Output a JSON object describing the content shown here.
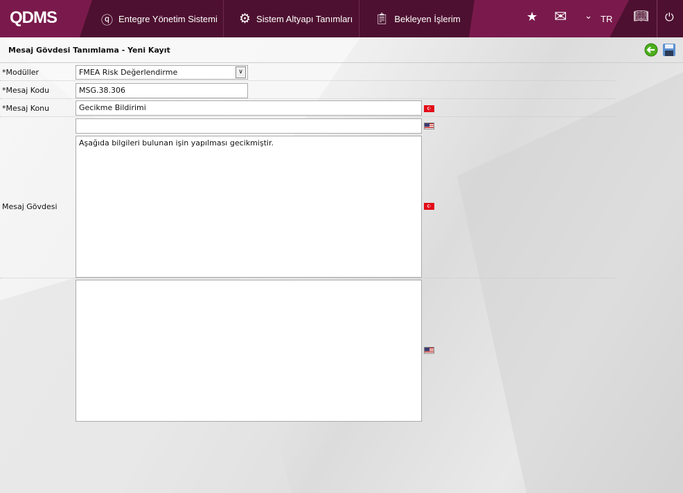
{
  "header": {
    "logo": "QDMS",
    "nav": [
      {
        "label": "Entegre Yönetim Sistemi",
        "icon": "q-icon"
      },
      {
        "label": "Sistem Altyapı Tanımları",
        "icon": "gear-icon"
      },
      {
        "label": "Bekleyen İşlerim",
        "icon": "clipboard-icon"
      }
    ],
    "language": "TR"
  },
  "page": {
    "title": "Mesaj Gövdesi Tanımlama - Yeni Kayıt"
  },
  "form": {
    "modules_label": "*Modüller",
    "modules_value": "FMEA Risk Değerlendirme",
    "code_label": "*Mesaj Kodu",
    "code_value": "MSG.38.306",
    "subject_label": "*Mesaj Konu",
    "subject_tr": "Gecikme Bildirimi",
    "subject_en": "",
    "body_label": "Mesaj Gövdesi",
    "body_tr": "Aşağıda bilgileri bulunan işin yapılması gecikmiştir.",
    "body_en": ""
  },
  "colors": {
    "header": "#7a1a4c",
    "header_dark": "#4e1030"
  }
}
